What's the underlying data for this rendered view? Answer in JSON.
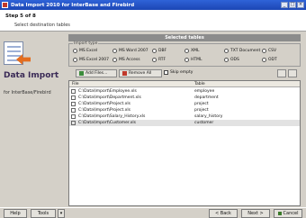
{
  "window": {
    "title": "Data Import 2010 for InterBase and Firebird",
    "controls": [
      "_",
      "□",
      "×"
    ]
  },
  "header": {
    "step": "Step 5 of 8",
    "subtitle": "Select destination tables"
  },
  "left_panel": {
    "brand": "Data Import",
    "brand_sub": "for InterBase/Firebird"
  },
  "section": {
    "title": "Selected tables"
  },
  "import_type": {
    "legend": "Import type",
    "options": [
      {
        "label": "MS Excel"
      },
      {
        "label": "MS Word 2007"
      },
      {
        "label": "DBF"
      },
      {
        "label": "XML"
      },
      {
        "label": "TXT Document"
      },
      {
        "label": "CSV"
      },
      {
        "label": "MS Excel 2007"
      },
      {
        "label": "MS Access"
      },
      {
        "label": "RTF"
      },
      {
        "label": "HTML"
      },
      {
        "label": "ODS"
      },
      {
        "label": "ODT"
      }
    ]
  },
  "toolbar": {
    "add_files": "Add Files...",
    "remove_all": "Remove All",
    "checkbox_label": "Skip empty"
  },
  "table": {
    "columns": [
      "File",
      "Table"
    ],
    "rows": [
      {
        "name": "C:\\Data\\Import\\Employee.xls",
        "type": "employee"
      },
      {
        "name": "C:\\Data\\Import\\Department.xls",
        "type": "department"
      },
      {
        "name": "C:\\Data\\Import\\Project.xls",
        "type": "project"
      },
      {
        "name": "C:\\Data\\Import\\Project.xls",
        "type": "project"
      },
      {
        "name": "C:\\Data\\Import\\Salary_History.xls",
        "type": "salary_history"
      },
      {
        "name": "C:\\Data\\Import\\Customer.xls",
        "type": "customer"
      }
    ]
  },
  "footer": {
    "help": "Help",
    "tools": "Tools",
    "back": "< Back",
    "next": "Next >",
    "cancel": "Cancel"
  }
}
